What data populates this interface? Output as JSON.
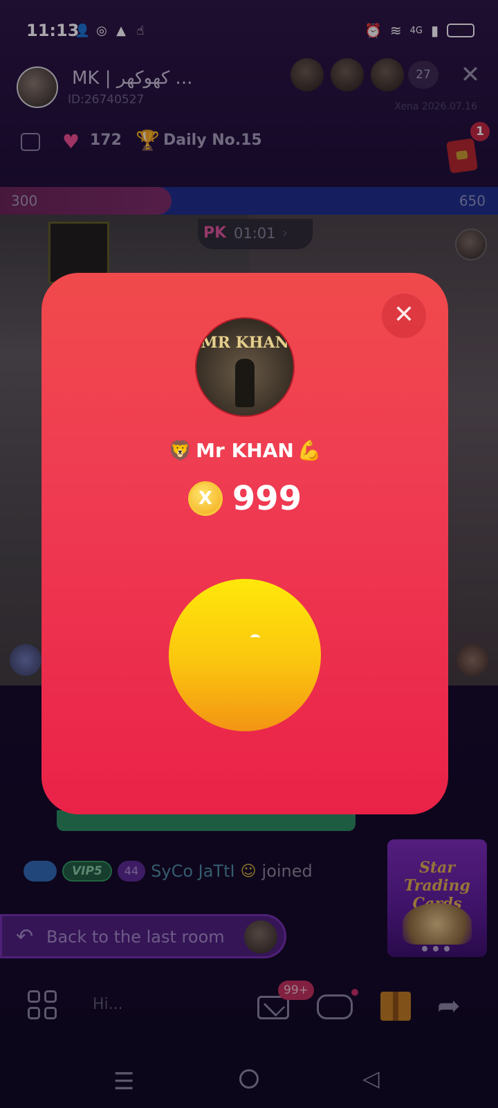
{
  "status_bar": {
    "time": "11:13",
    "left_icons": [
      "person-add-icon",
      "whatsapp-icon",
      "drive-icon",
      "touch-icon"
    ],
    "right_icons": [
      "alarm-icon",
      "wifi-icon",
      "signal-icon"
    ],
    "network": "4G",
    "battery": "31"
  },
  "room": {
    "host_name": "MK | کھوکھر ...",
    "host_id": "ID:26740527",
    "viewer_count": "27",
    "watermark": "Xena 2026.07.16",
    "likes": "172",
    "daily_rank": "Daily No.15",
    "red_packet_badge": "1"
  },
  "pk": {
    "left_score": "300",
    "right_score": "650",
    "label": "PK",
    "timer": "01:01"
  },
  "chat": {
    "vip_badge": "VIP5",
    "gem_badge": "44",
    "join_name": "SyCo JaTtI",
    "join_text": "joined",
    "back_label": "Back to the last room"
  },
  "promo": {
    "title": "Star Trading Cards"
  },
  "toolbar": {
    "input_placeholder": "Hi...",
    "mail_badge": "99+"
  },
  "modal": {
    "avatar_banner": "MR KHAN",
    "sender_name": "Mr KHAN",
    "amount": "999",
    "coin_symbol": "X"
  },
  "colors": {
    "modal_top": "#f04a4c",
    "modal_bottom": "#ea2248",
    "open_button_top": "#ffe80a",
    "open_button_bottom": "#f39414",
    "background": "#1a0f2e"
  }
}
